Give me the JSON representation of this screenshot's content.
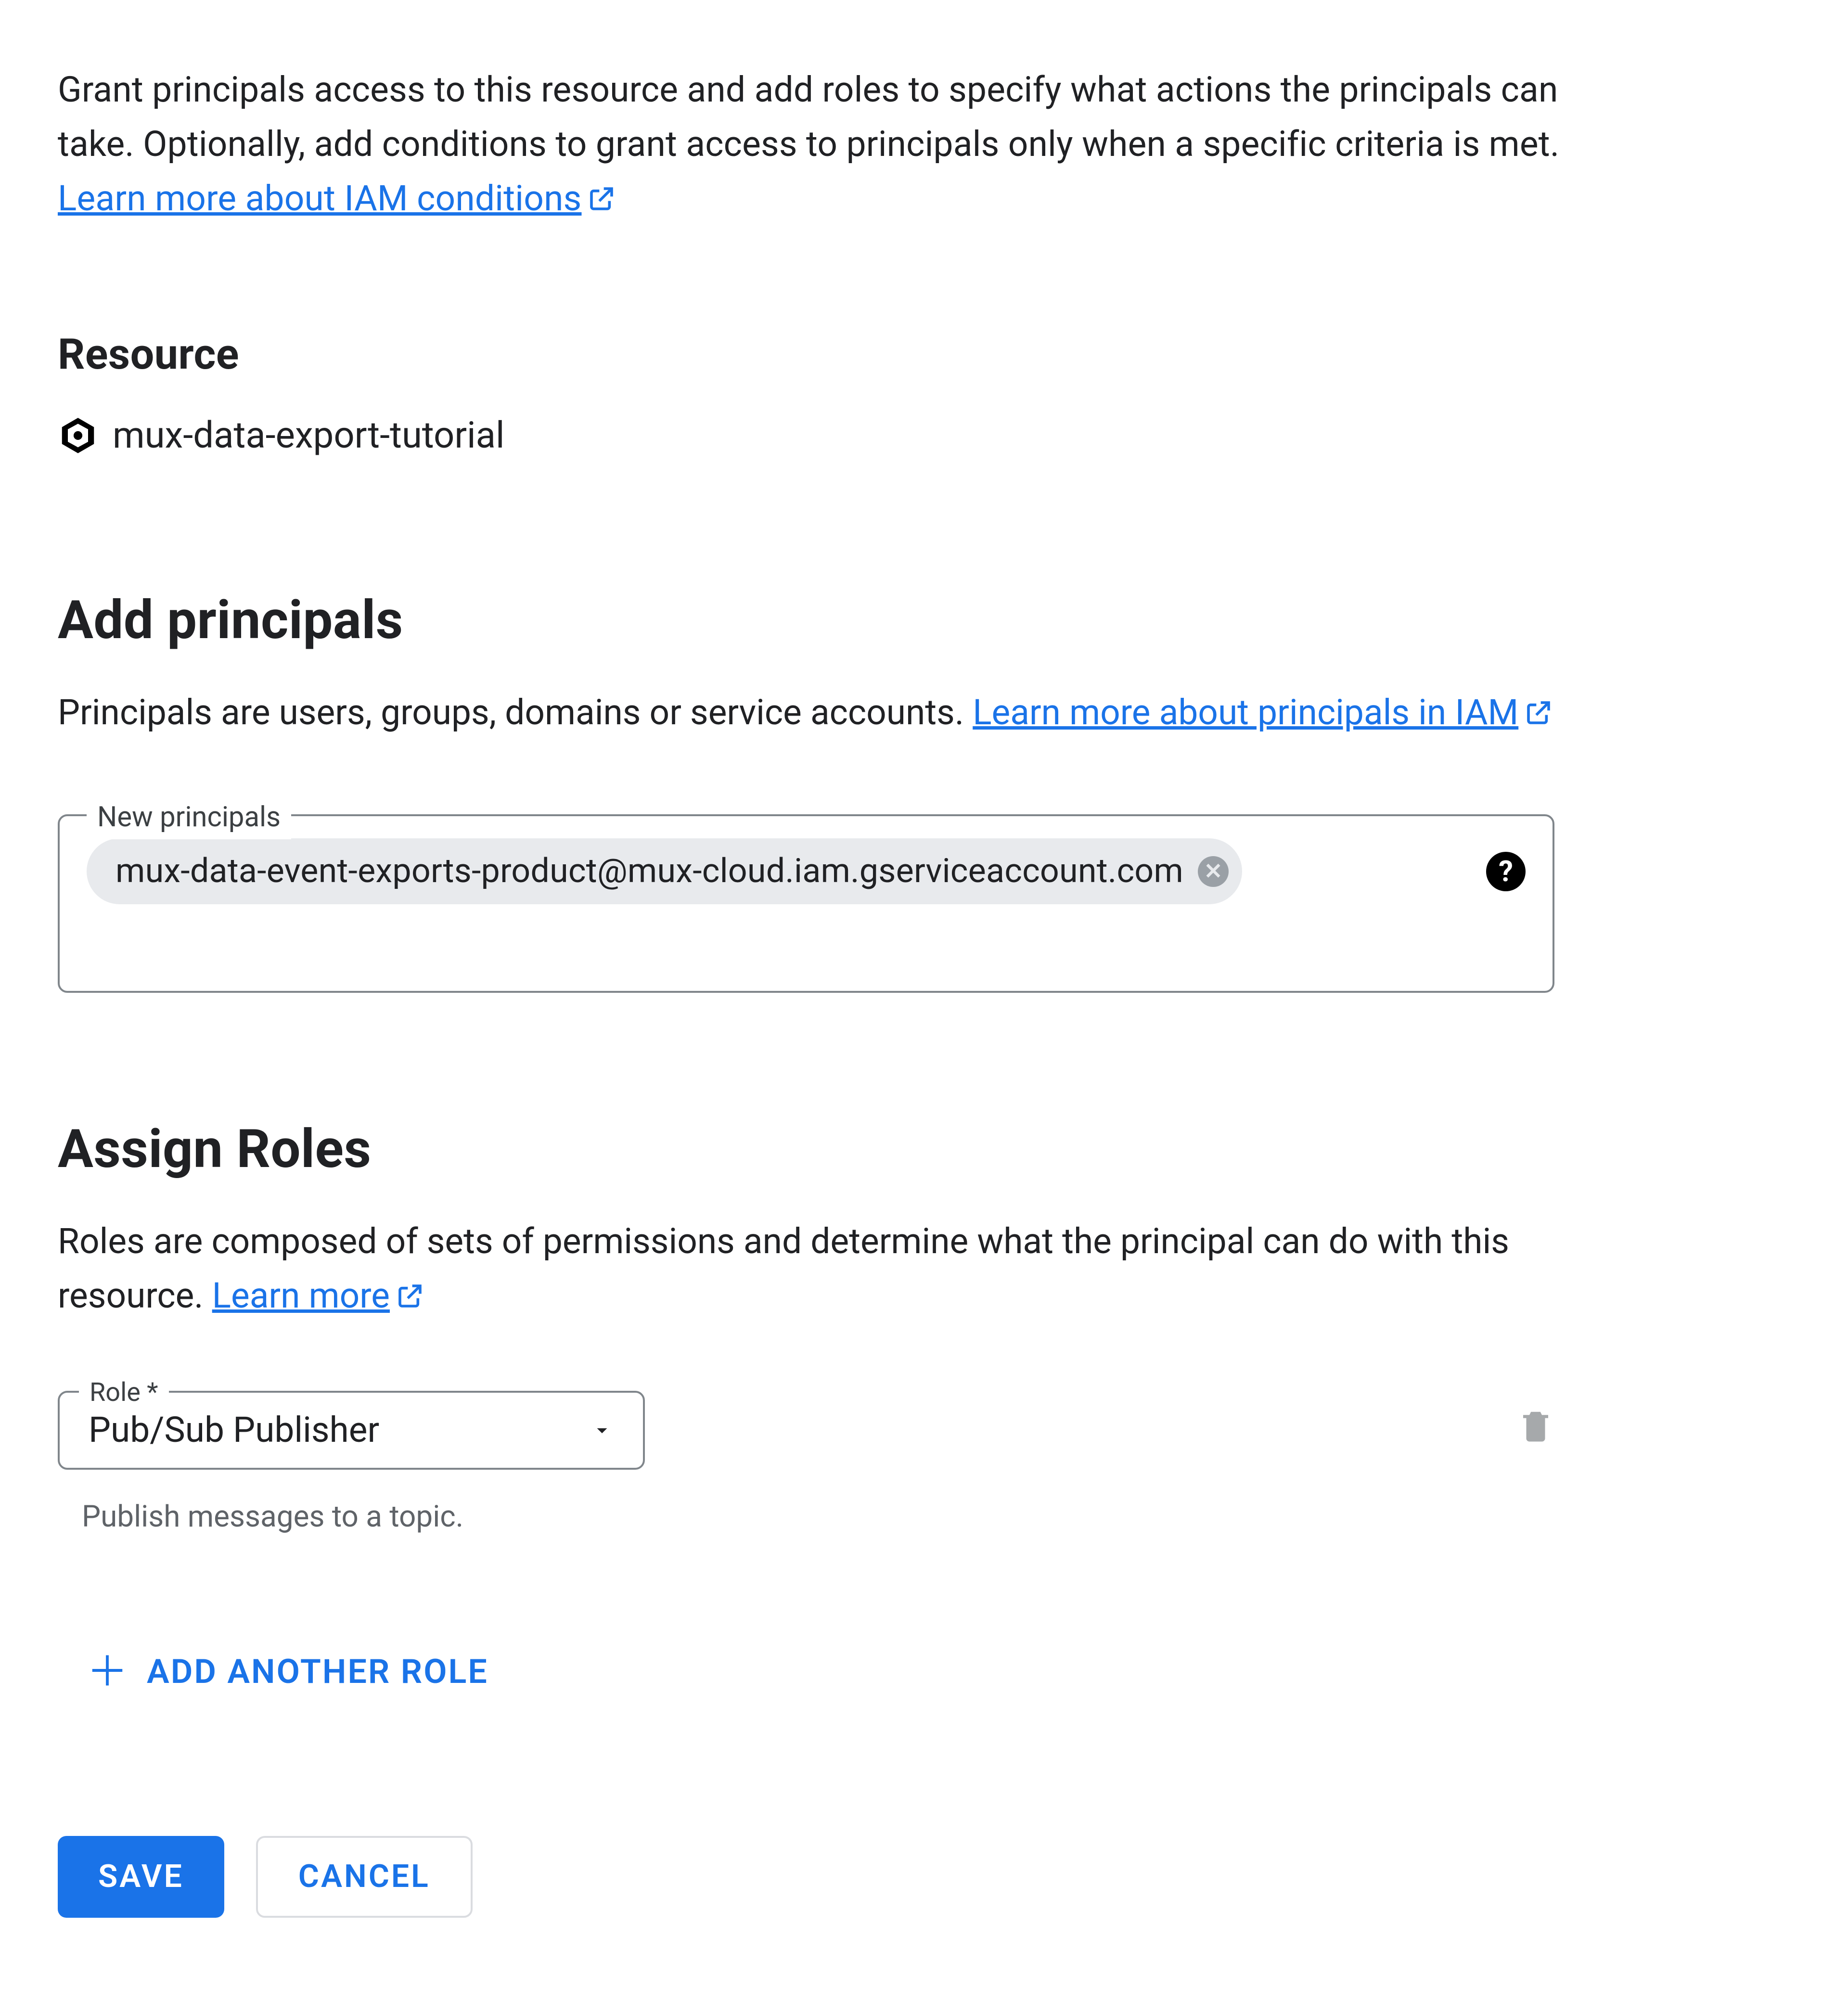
{
  "intro": {
    "text": "Grant principals access to this resource and add roles to specify what actions the principals can take. Optionally, add conditions to grant access to principals only when a specific criteria is met. ",
    "link": "Learn more about IAM conditions"
  },
  "resource": {
    "heading": "Resource",
    "name": "mux-data-export-tutorial"
  },
  "principals": {
    "heading": "Add principals",
    "description_pre": "Principals are users, groups, domains or service accounts. ",
    "link": "Learn more about principals in IAM",
    "field_label": "New principals",
    "chip": "mux-data-event-exports-product@mux-cloud.iam.gserviceaccount.com"
  },
  "roles": {
    "heading": "Assign Roles",
    "description_pre": "Roles are composed of sets of permissions and determine what the principal can do with this resource. ",
    "link": "Learn more",
    "field_label": "Role *",
    "selected": "Pub/Sub Publisher",
    "hint": "Publish messages to a topic.",
    "add_another": "ADD ANOTHER ROLE"
  },
  "actions": {
    "save": "SAVE",
    "cancel": "CANCEL"
  }
}
